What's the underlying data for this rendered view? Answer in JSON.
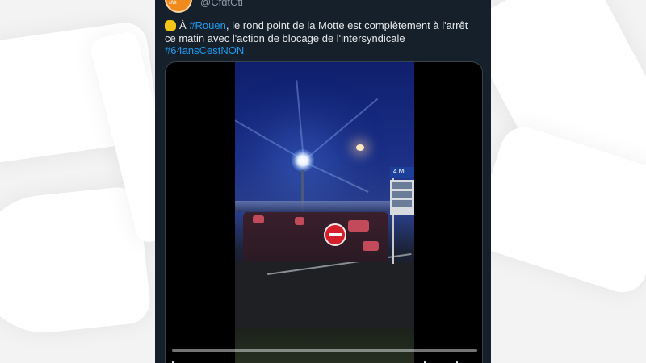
{
  "tweet": {
    "handle": "@CfdtCti",
    "avatar_label": "cfdt",
    "text_prefix": "À ",
    "hashtag_city": "#Rouen",
    "text_body": ", le rond point de la Motte est complètement à l'arrêt ce matin avec l'action de blocage de l'intersyndicale",
    "hashtag_main": "#64ansCestNON",
    "emoji": "raised-fist-icon"
  },
  "video": {
    "sign_label": "4 Mi",
    "progress": 0.0
  },
  "colors": {
    "tweet_bg": "#15202b",
    "link": "#1d9bf0",
    "text": "#e7e9ea",
    "muted": "#8b98a5"
  }
}
